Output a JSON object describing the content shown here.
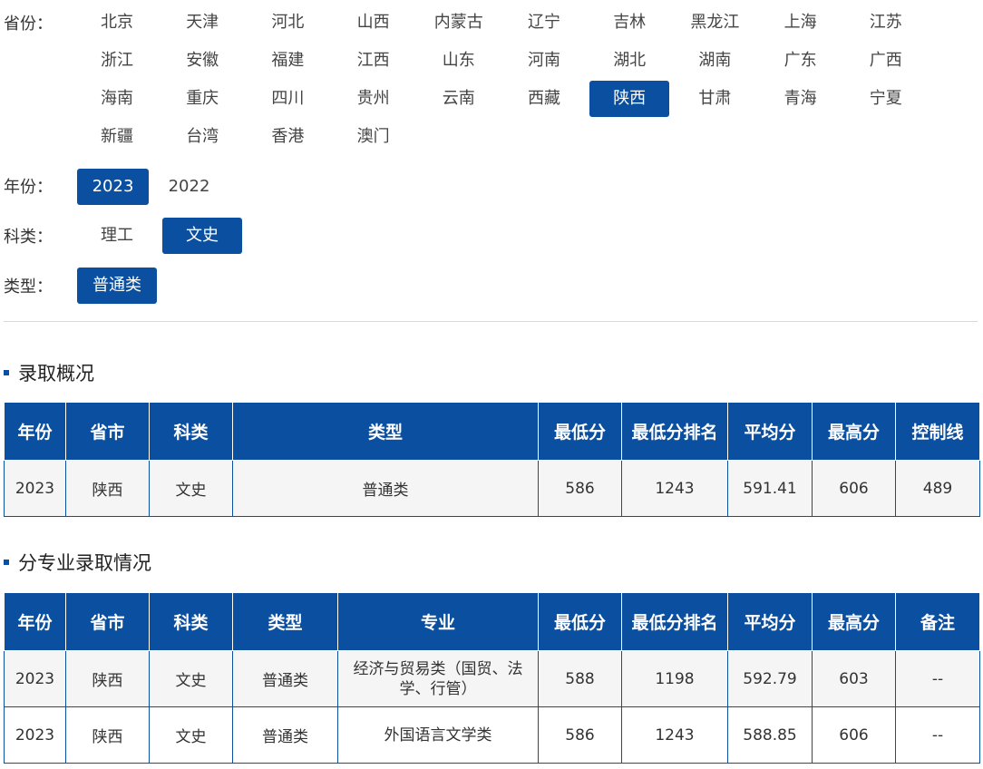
{
  "filters": {
    "province_label": "省份：",
    "provinces": [
      "北京",
      "天津",
      "河北",
      "山西",
      "内蒙古",
      "辽宁",
      "吉林",
      "黑龙江",
      "上海",
      "江苏",
      "浙江",
      "安徽",
      "福建",
      "江西",
      "山东",
      "河南",
      "湖北",
      "湖南",
      "广东",
      "广西",
      "海南",
      "重庆",
      "四川",
      "贵州",
      "云南",
      "西藏",
      "陕西",
      "甘肃",
      "青海",
      "宁夏",
      "新疆",
      "台湾",
      "香港",
      "澳门"
    ],
    "province_selected": "陕西",
    "year_label": "年份：",
    "years": [
      "2023",
      "2022"
    ],
    "year_selected": "2023",
    "subject_label": "科类：",
    "subjects": [
      "理工",
      "文史"
    ],
    "subject_selected": "文史",
    "type_label": "类型：",
    "types": [
      "普通类"
    ],
    "type_selected": "普通类"
  },
  "summary": {
    "title": "录取概况",
    "headers": [
      "年份",
      "省市",
      "科类",
      "类型",
      "最低分",
      "最低分排名",
      "平均分",
      "最高分",
      "控制线"
    ],
    "rows": [
      [
        "2023",
        "陕西",
        "文史",
        "普通类",
        "586",
        "1243",
        "591.41",
        "606",
        "489"
      ]
    ]
  },
  "majors": {
    "title": "分专业录取情况",
    "headers": [
      "年份",
      "省市",
      "科类",
      "类型",
      "专业",
      "最低分",
      "最低分排名",
      "平均分",
      "最高分",
      "备注"
    ],
    "rows": [
      [
        "2023",
        "陕西",
        "文史",
        "普通类",
        "经济与贸易类（国贸、法学、行管）",
        "588",
        "1198",
        "592.79",
        "603",
        "--"
      ],
      [
        "2023",
        "陕西",
        "文史",
        "普通类",
        "外国语言文学类",
        "586",
        "1243",
        "588.85",
        "606",
        "--"
      ]
    ]
  },
  "colors": {
    "accent": "#0b4fa0",
    "row_alt": "#f5f5f5"
  }
}
